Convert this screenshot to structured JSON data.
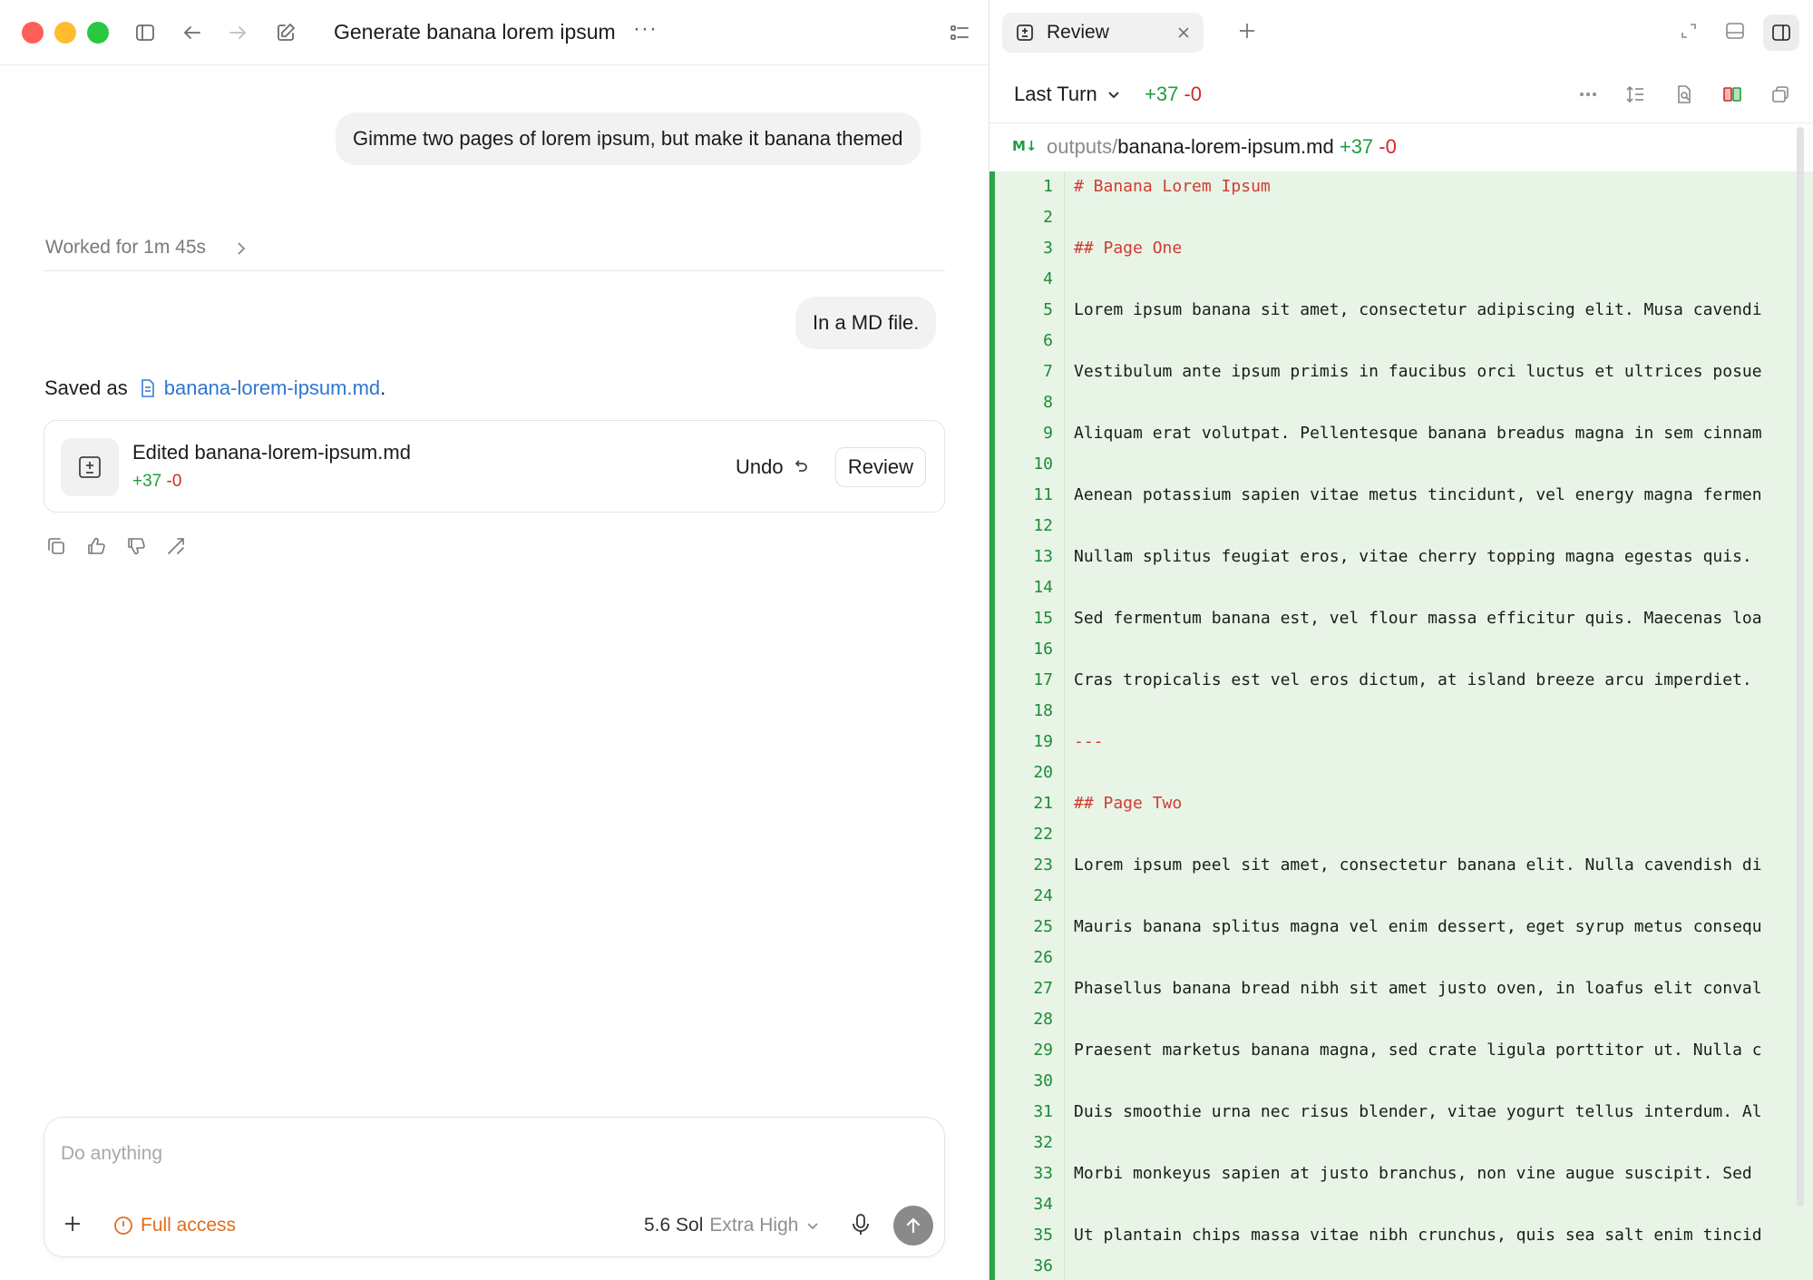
{
  "window": {
    "title": "Generate banana lorem ipsum"
  },
  "chat": {
    "user_message_1": "Gimme two pages of lorem ipsum, but make it banana themed",
    "worked_for": "Worked for 1m 45s",
    "user_message_2": "In a MD file.",
    "saved_prefix": "Saved as",
    "saved_file": "banana-lorem-ipsum.md",
    "saved_suffix": ".",
    "edit_card": {
      "title": "Edited banana-lorem-ipsum.md",
      "additions": "+37",
      "deletions": "-0",
      "undo_label": "Undo",
      "review_label": "Review"
    }
  },
  "composer": {
    "placeholder": "Do anything",
    "access_label": "Full access",
    "model": "5.6 Sol",
    "effort": "Extra High"
  },
  "review_pane": {
    "tab_label": "Review",
    "scope_label": "Last Turn",
    "additions": "+37",
    "deletions": "-0",
    "file": {
      "badge": "M↓",
      "dir": "outputs/",
      "name": "banana-lorem-ipsum.md",
      "additions": "+37",
      "deletions": "-0"
    },
    "lines": [
      {
        "n": "1",
        "t": "# Banana Lorem Ipsum"
      },
      {
        "n": "2",
        "t": ""
      },
      {
        "n": "3",
        "t": "## Page One"
      },
      {
        "n": "4",
        "t": ""
      },
      {
        "n": "5",
        "t": "Lorem ipsum banana sit amet, consectetur adipiscing elit. Musa cavendi"
      },
      {
        "n": "6",
        "t": ""
      },
      {
        "n": "7",
        "t": "Vestibulum ante ipsum primis in faucibus orci luctus et ultrices posue"
      },
      {
        "n": "8",
        "t": ""
      },
      {
        "n": "9",
        "t": "Aliquam erat volutpat. Pellentesque banana breadus magna in sem cinnam"
      },
      {
        "n": "10",
        "t": ""
      },
      {
        "n": "11",
        "t": "Aenean potassium sapien vitae metus tincidunt, vel energy magna fermen"
      },
      {
        "n": "12",
        "t": ""
      },
      {
        "n": "13",
        "t": "Nullam splitus feugiat eros, vitae cherry topping magna egestas quis."
      },
      {
        "n": "14",
        "t": ""
      },
      {
        "n": "15",
        "t": "Sed fermentum banana est, vel flour massa efficitur quis. Maecenas loa"
      },
      {
        "n": "16",
        "t": ""
      },
      {
        "n": "17",
        "t": "Cras tropicalis est vel eros dictum, at island breeze arcu imperdiet."
      },
      {
        "n": "18",
        "t": ""
      },
      {
        "n": "19",
        "t": "---"
      },
      {
        "n": "20",
        "t": ""
      },
      {
        "n": "21",
        "t": "## Page Two"
      },
      {
        "n": "22",
        "t": ""
      },
      {
        "n": "23",
        "t": "Lorem ipsum peel sit amet, consectetur banana elit. Nulla cavendish di"
      },
      {
        "n": "24",
        "t": ""
      },
      {
        "n": "25",
        "t": "Mauris banana splitus magna vel enim dessert, eget syrup metus consequ"
      },
      {
        "n": "26",
        "t": ""
      },
      {
        "n": "27",
        "t": "Phasellus banana bread nibh sit amet justo oven, in loafus elit conval"
      },
      {
        "n": "28",
        "t": ""
      },
      {
        "n": "29",
        "t": "Praesent marketus banana magna, sed crate ligula porttitor ut. Nulla c"
      },
      {
        "n": "30",
        "t": ""
      },
      {
        "n": "31",
        "t": "Duis smoothie urna nec risus blender, vitae yogurt tellus interdum. Al"
      },
      {
        "n": "32",
        "t": ""
      },
      {
        "n": "33",
        "t": "Morbi monkeyus sapien at justo branchus, non vine augue suscipit. Sed"
      },
      {
        "n": "34",
        "t": ""
      },
      {
        "n": "35",
        "t": "Ut plantain chips massa vitae nibh crunchus, quis sea salt enim tincid"
      },
      {
        "n": "36",
        "t": ""
      }
    ]
  },
  "colors": {
    "addition": "#1f9d3d",
    "deletion": "#d3272c",
    "link": "#2f76d2",
    "warning": "#e06d1b",
    "diff_bg": "#e8f5e6"
  }
}
